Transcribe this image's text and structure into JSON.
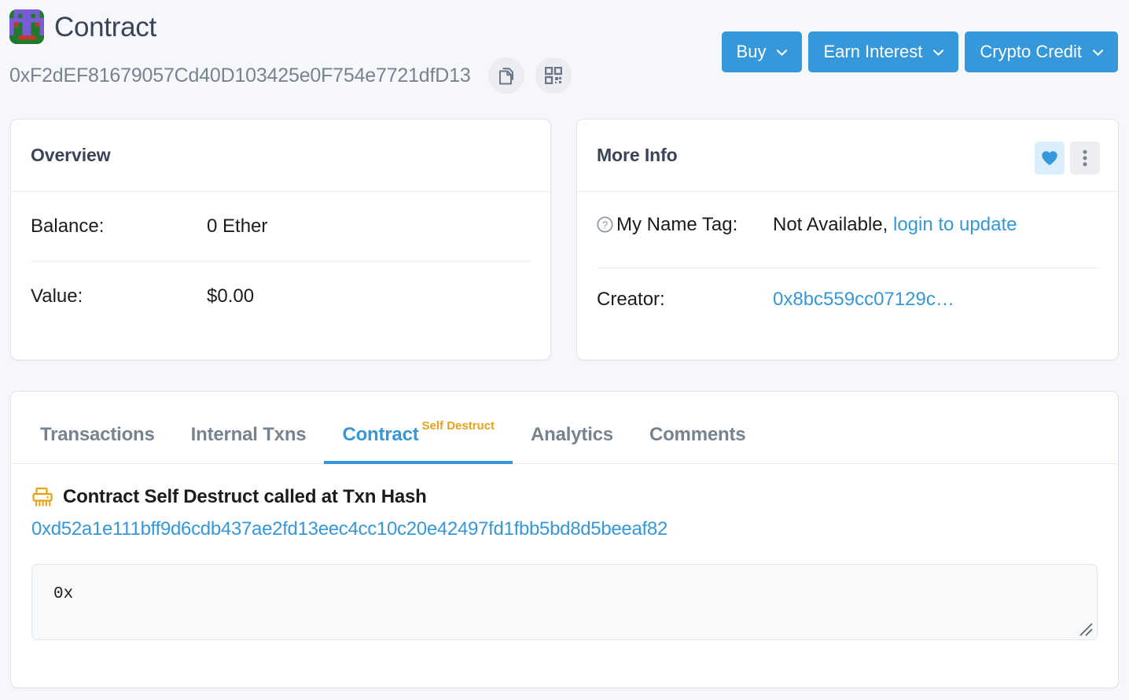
{
  "header": {
    "avatar_icon": "identicon-avatar",
    "title": "Contract",
    "address": "0xF2dEF81679057Cd40D103425e0F754e7721dfD13",
    "copy_icon": "copy-icon",
    "qr_icon": "qr-code-icon",
    "buttons": [
      {
        "label": "Buy",
        "icon": "chevron-down-icon"
      },
      {
        "label": "Earn Interest",
        "icon": "chevron-down-icon"
      },
      {
        "label": "Crypto Credit",
        "icon": "chevron-down-icon"
      }
    ]
  },
  "overview": {
    "title": "Overview",
    "rows": [
      {
        "label": "Balance:",
        "value": "0 Ether"
      },
      {
        "label": "Value:",
        "value": "$0.00"
      }
    ]
  },
  "more_info": {
    "title": "More Info",
    "favorite_icon": "heart-icon",
    "more_icon": "kebab-menu-icon",
    "name_tag": {
      "help_icon": "question-circle-icon",
      "label": "My Name Tag:",
      "value": "Not Available,",
      "link": "login to update"
    },
    "creator": {
      "label": "Creator:",
      "value": "0x8bc559cc07129c…"
    }
  },
  "tabs": [
    {
      "label": "Transactions",
      "active": false,
      "badge": ""
    },
    {
      "label": "Internal Txns",
      "active": false,
      "badge": ""
    },
    {
      "label": "Contract",
      "active": true,
      "badge": "Self Destruct"
    },
    {
      "label": "Analytics",
      "active": false,
      "badge": ""
    },
    {
      "label": "Comments",
      "active": false,
      "badge": ""
    }
  ],
  "self_destruct": {
    "icon": "shredder-icon",
    "heading": "Contract Self Destruct called at Txn Hash",
    "txn_hash": "0xd52a1e111bff9d6cdb437ae2fd13eec4cc10c20e42497fd1fbb5bd8d5beeaf82",
    "code_value": "0x"
  },
  "colors": {
    "accent_blue": "#3498db",
    "badge_orange": "#e8a317",
    "page_background": "#f6f7fb",
    "muted_text": "#77838f"
  }
}
